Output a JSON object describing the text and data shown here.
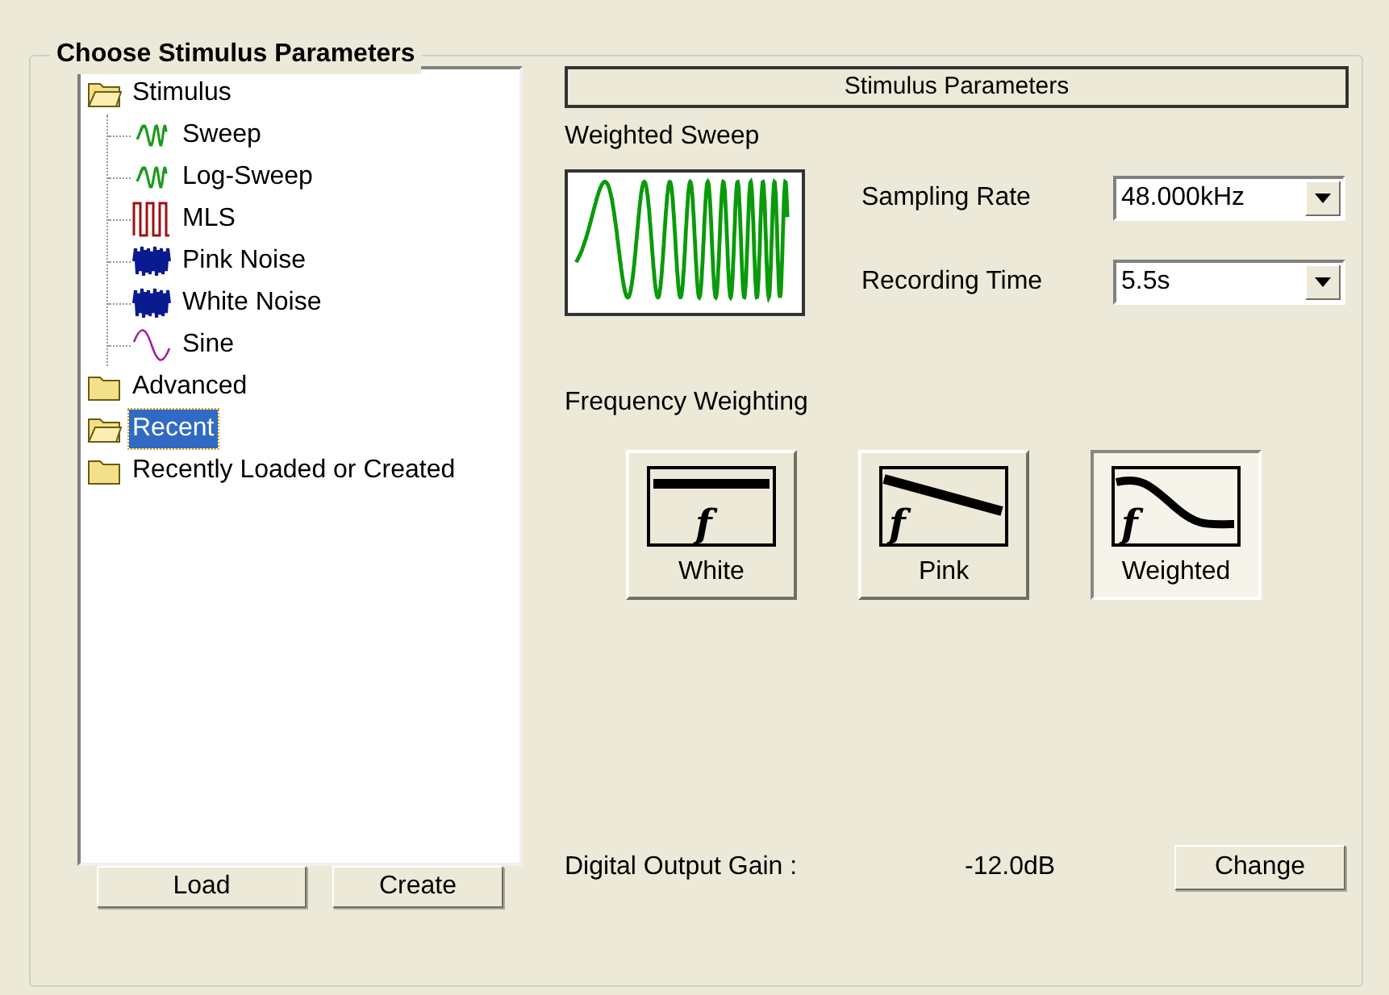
{
  "group_title": "Choose Stimulus Parameters",
  "tree": [
    {
      "label": "Stimulus",
      "kind": "open-folder",
      "selected": false,
      "children": [
        {
          "label": "Sweep",
          "kind": "sweep",
          "selected": false
        },
        {
          "label": "Log-Sweep",
          "kind": "sweep",
          "selected": false
        },
        {
          "label": "MLS",
          "kind": "mls",
          "selected": false
        },
        {
          "label": "Pink Noise",
          "kind": "noise",
          "selected": false
        },
        {
          "label": "White Noise",
          "kind": "noise",
          "selected": false
        },
        {
          "label": "Sine",
          "kind": "sine",
          "selected": false
        }
      ]
    },
    {
      "label": "Advanced",
      "kind": "folder",
      "selected": false
    },
    {
      "label": "Recent",
      "kind": "open-folder",
      "selected": true
    },
    {
      "label": "Recently Loaded or Created",
      "kind": "folder",
      "selected": false
    }
  ],
  "tree_buttons": [
    "Load",
    "Create"
  ],
  "params_header": "Stimulus Parameters",
  "stimulus_name": "Weighted Sweep",
  "fields": [
    {
      "label": "Sampling Rate",
      "value": "48.000kHz"
    },
    {
      "label": "Recording Time",
      "value": "5.5s"
    }
  ],
  "weighting_label": "Frequency Weighting",
  "weightings": [
    {
      "label": "White",
      "symbol": "f",
      "kind": "flat",
      "selected": false
    },
    {
      "label": "Pink",
      "symbol": "f",
      "kind": "slope",
      "selected": false
    },
    {
      "label": "Weighted",
      "symbol": "f",
      "kind": "curve",
      "selected": true
    }
  ],
  "gain_label": "Digital Output Gain :",
  "gain_value": "-12.0dB",
  "change_button": "Change"
}
